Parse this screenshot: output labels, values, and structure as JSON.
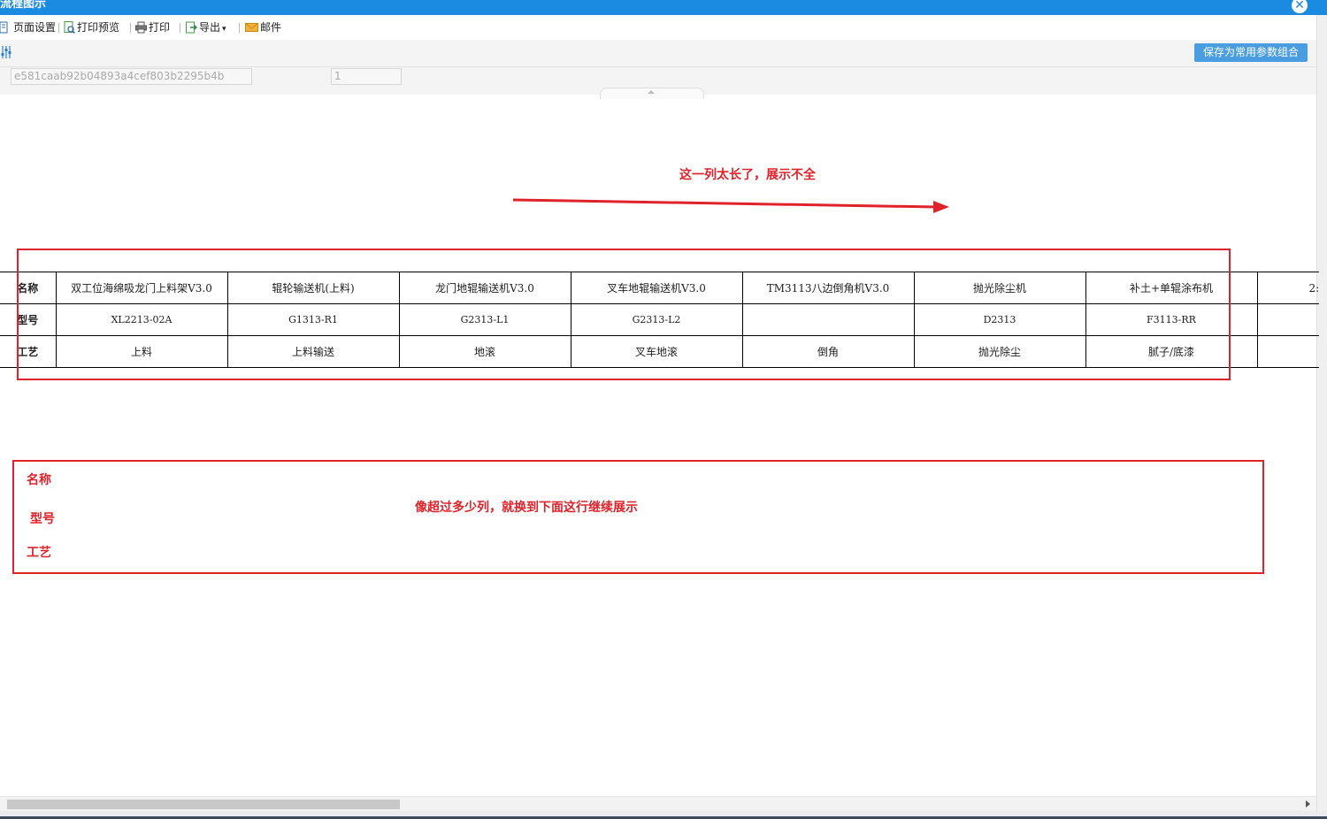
{
  "window": {
    "title": "流程图示",
    "close_glyph": "✕"
  },
  "toolbar": {
    "items": [
      {
        "label": "页面设置",
        "icon": "page-setup-icon"
      },
      {
        "label": "打印预览",
        "icon": "print-preview-icon"
      },
      {
        "label": "打印",
        "icon": "printer-icon"
      },
      {
        "label": "导出",
        "icon": "export-icon",
        "has_dropdown": true
      },
      {
        "label": "邮件",
        "icon": "mail-icon"
      }
    ],
    "dropdown_glyph": "▾"
  },
  "params": {
    "save_button": "保存为常用参数组合",
    "id_value": "e581caab92b04893a4cef803b2295b4b",
    "count_value": "1"
  },
  "annotations": {
    "top_note": "这一列太长了，展示不全",
    "bottom_note": "像超过多少列，就换到下面这行继续展示",
    "bottom_labels": [
      "名称",
      "型号",
      "工艺"
    ],
    "color": "#e0232b"
  },
  "table": {
    "row_headers": [
      "名称",
      "型号",
      "工艺"
    ],
    "columns": [
      {
        "name": "双工位海绵吸龙门上料架V3.0",
        "model": "XL2213-02A",
        "process": "上料"
      },
      {
        "name": "辊轮输送机(上料)",
        "model": "G1313-R1",
        "process": "上料输送"
      },
      {
        "name": "龙门地辊输送机V3.0",
        "model": "G2313-L1",
        "process": "地滚"
      },
      {
        "name": "叉车地辊输送机V3.0",
        "model": "G2313-L2",
        "process": "叉车地滚"
      },
      {
        "name": "TM3113八边倒角机V3.0",
        "model": "",
        "process": "倒角"
      },
      {
        "name": "抛光除尘机",
        "model": "D2313",
        "process": "抛光除尘"
      },
      {
        "name": "补土+单辊涂布机",
        "model": "F3113-RR",
        "process": "腻子/底漆"
      }
    ],
    "cut_column_text": "2:"
  }
}
